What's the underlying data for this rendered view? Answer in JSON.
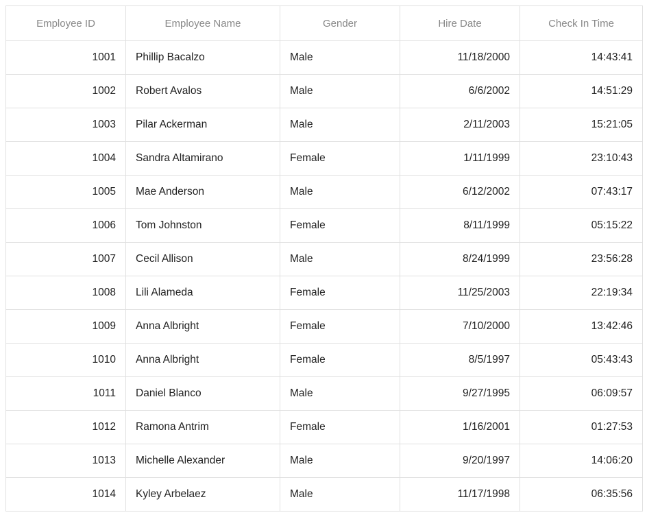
{
  "columns": [
    {
      "label": "Employee ID"
    },
    {
      "label": "Employee Name"
    },
    {
      "label": "Gender"
    },
    {
      "label": "Hire Date"
    },
    {
      "label": "Check In Time"
    }
  ],
  "rows": [
    {
      "id": "1001",
      "name": "Phillip Bacalzo",
      "gender": "Male",
      "hire_date": "11/18/2000",
      "check_in": "14:43:41"
    },
    {
      "id": "1002",
      "name": "Robert Avalos",
      "gender": "Male",
      "hire_date": "6/6/2002",
      "check_in": "14:51:29"
    },
    {
      "id": "1003",
      "name": "Pilar Ackerman",
      "gender": "Male",
      "hire_date": "2/11/2003",
      "check_in": "15:21:05"
    },
    {
      "id": "1004",
      "name": "Sandra Altamirano",
      "gender": "Female",
      "hire_date": "1/11/1999",
      "check_in": "23:10:43"
    },
    {
      "id": "1005",
      "name": "Mae Anderson",
      "gender": "Male",
      "hire_date": "6/12/2002",
      "check_in": "07:43:17"
    },
    {
      "id": "1006",
      "name": "Tom Johnston",
      "gender": "Female",
      "hire_date": "8/11/1999",
      "check_in": "05:15:22"
    },
    {
      "id": "1007",
      "name": "Cecil Allison",
      "gender": "Male",
      "hire_date": "8/24/1999",
      "check_in": "23:56:28"
    },
    {
      "id": "1008",
      "name": "Lili Alameda",
      "gender": "Female",
      "hire_date": "11/25/2003",
      "check_in": "22:19:34"
    },
    {
      "id": "1009",
      "name": "Anna Albright",
      "gender": "Female",
      "hire_date": "7/10/2000",
      "check_in": "13:42:46"
    },
    {
      "id": "1010",
      "name": "Anna Albright",
      "gender": "Female",
      "hire_date": "8/5/1997",
      "check_in": "05:43:43"
    },
    {
      "id": "1011",
      "name": "Daniel Blanco",
      "gender": "Male",
      "hire_date": "9/27/1995",
      "check_in": "06:09:57"
    },
    {
      "id": "1012",
      "name": "Ramona Antrim",
      "gender": "Female",
      "hire_date": "1/16/2001",
      "check_in": "01:27:53"
    },
    {
      "id": "1013",
      "name": "Michelle Alexander",
      "gender": "Male",
      "hire_date": "9/20/1997",
      "check_in": "14:06:20"
    },
    {
      "id": "1014",
      "name": "Kyley Arbelaez",
      "gender": "Male",
      "hire_date": "11/17/1998",
      "check_in": "06:35:56"
    }
  ]
}
